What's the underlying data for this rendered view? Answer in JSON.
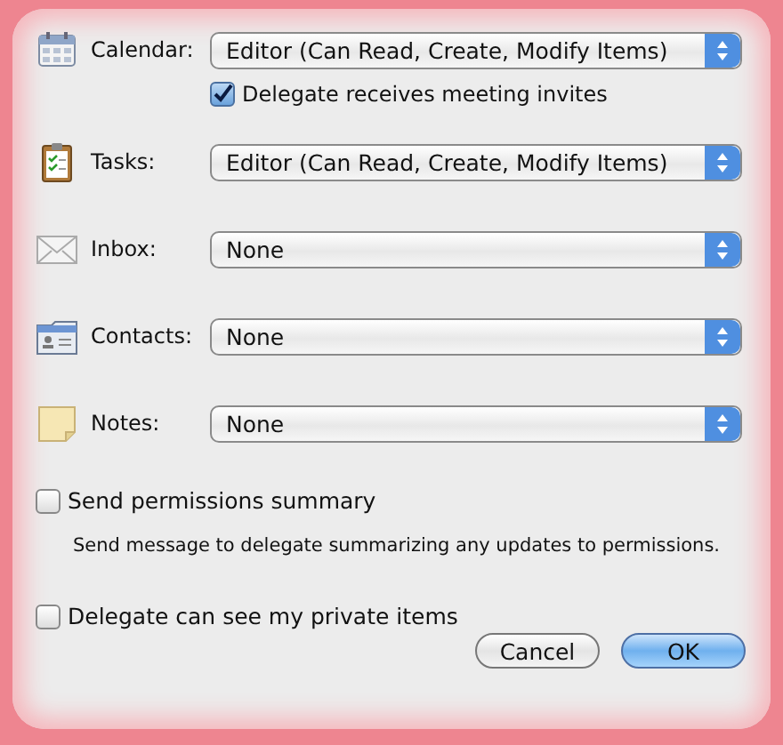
{
  "permissions": [
    {
      "label": "Calendar:",
      "value": "Editor (Can Read, Create, Modify Items)",
      "option": {
        "label": "Delegate receives meeting invites",
        "checked": true
      }
    },
    {
      "label": "Tasks:",
      "value": "Editor (Can Read, Create, Modify Items)"
    },
    {
      "label": "Inbox:",
      "value": "None"
    },
    {
      "label": "Contacts:",
      "value": "None"
    },
    {
      "label": "Notes:",
      "value": "None"
    }
  ],
  "summary": {
    "label": "Send permissions summary",
    "checked": false,
    "note": "Send message to delegate summarizing any updates to permissions."
  },
  "private_items": {
    "label": "Delegate can see my private items",
    "checked": false
  },
  "buttons": [
    {
      "label": "Cancel",
      "default": false
    },
    {
      "label": "OK",
      "default": true
    }
  ]
}
